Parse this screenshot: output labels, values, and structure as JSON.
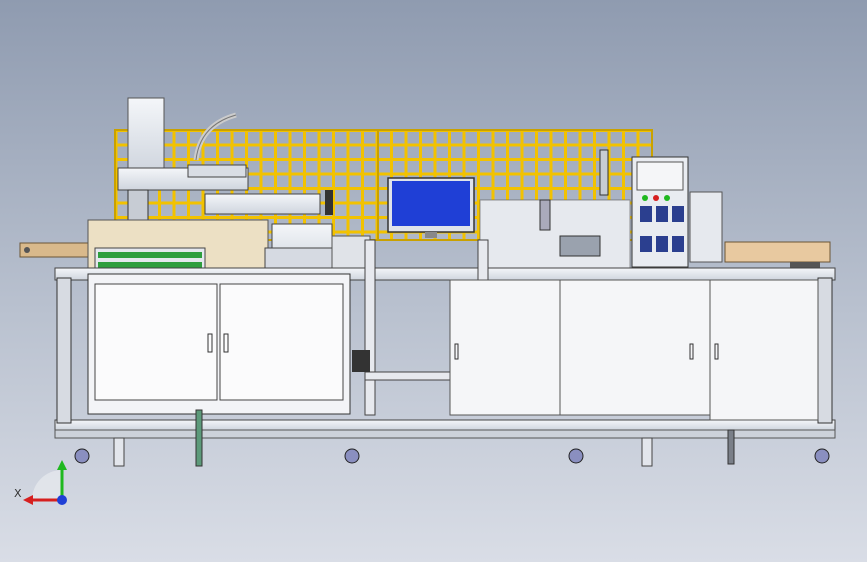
{
  "viewport": {
    "background_top": "#8f9bb0",
    "background_bottom": "#d9dde6",
    "model_description_visible": false
  },
  "colors": {
    "fence": "#f2c200",
    "frame": "#dfe3ea",
    "frame_edge": "#6b7280",
    "screen": "#1f3fd6",
    "belt": "#2e9e3e",
    "panel_blue": "#2b3f8f",
    "triad_x": "#d61f1f",
    "triad_y": "#1fb81f",
    "triad_z": "#1f3fd6"
  },
  "triad": {
    "x_label": "X",
    "icon": "axis-triad-icon"
  }
}
